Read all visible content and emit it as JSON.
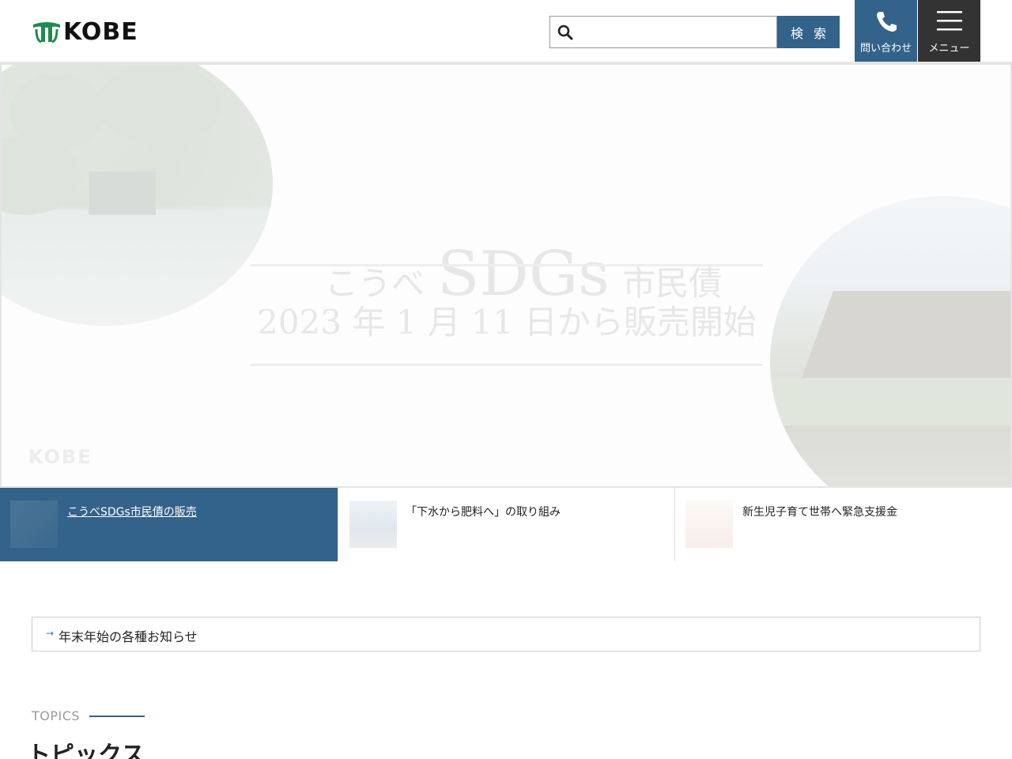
{
  "header": {
    "logo_text": "KOBE",
    "search": {
      "placeholder": "",
      "button_label": "検 索"
    },
    "contact_label": "問い合わせ",
    "menu_label": "メニュー"
  },
  "hero": {
    "title_pre": "こうべ",
    "title_main": "SDGs",
    "title_post": "市民債",
    "subtitle": "2023 年 1 月 11 日から販売開始",
    "logo_text": "KOBE"
  },
  "features": [
    {
      "label": "こうべSDGs市民債の販売",
      "active": true
    },
    {
      "label": "「下水から肥料へ」の取り組み",
      "active": false
    },
    {
      "label": "新生児子育て世帯へ緊急支援金",
      "active": false
    }
  ],
  "notice": {
    "label": "年末年始の各種お知らせ"
  },
  "topics": {
    "en": "TOPICS",
    "ja": "トピックス"
  },
  "colors": {
    "accent": "#33628a",
    "menu": "#333333",
    "logo_green": "#1f8a4c"
  }
}
